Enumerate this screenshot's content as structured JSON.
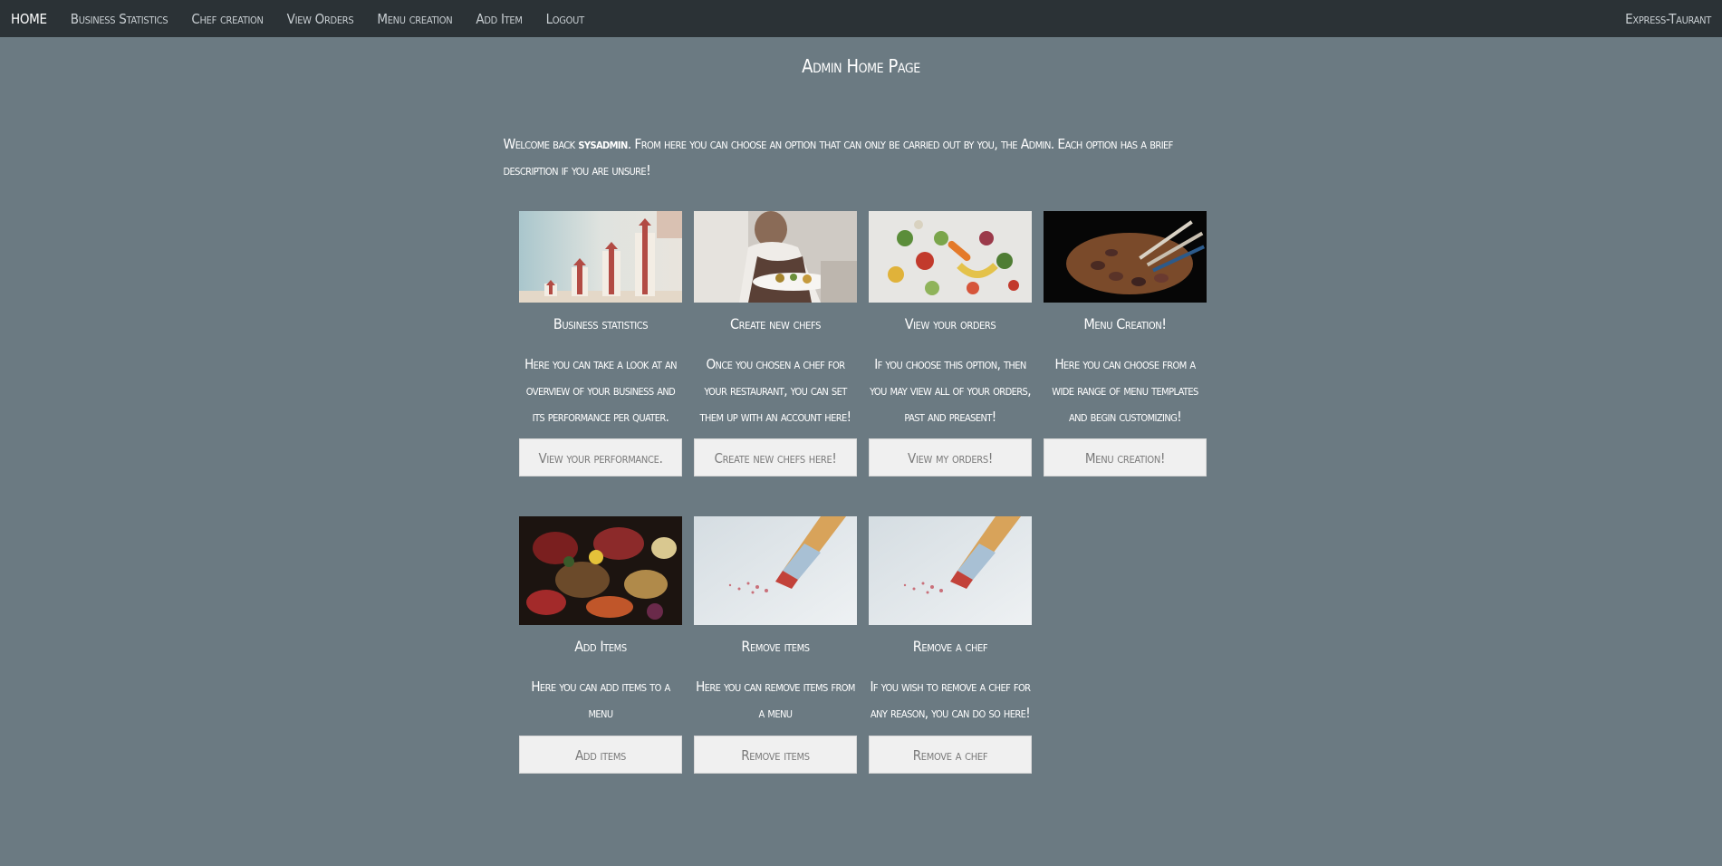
{
  "nav": {
    "items": [
      "HOME",
      "Business Statistics",
      "Chef creation",
      "View Orders",
      "Menu creation",
      "Add Item",
      "Logout"
    ],
    "brand": "Express-Taurant"
  },
  "page": {
    "title": "Admin Home Page",
    "welcome_prefix": "Welcome back ",
    "username": "sysadmin",
    "welcome_suffix": ". From here you can choose an option that can only be carried out by you, the Admin. Each option has a brief description if you are unsure!"
  },
  "cards": [
    {
      "title": "Business statistics",
      "desc": "Here you can take a look at an overview of your business and its performance per quater.",
      "button": "View your performance.",
      "image": "growth-chart-image"
    },
    {
      "title": "Create new chefs",
      "desc": "Once you chosen a chef for your restaurant, you can set them up with an account here!",
      "button": "Create new chefs here!",
      "image": "chef-cooking-image"
    },
    {
      "title": "View your orders",
      "desc": "If you choose this option, then you may view all of your orders, past and preasent!",
      "button": "View my orders!",
      "image": "vegetables-image"
    },
    {
      "title": "Menu Creation!",
      "desc": "Here you can choose from a wide range of menu templates and begin customizing!",
      "button": "Menu creation!",
      "image": "paint-palette-image"
    },
    {
      "title": "Add Items",
      "desc": "Here you can add items to a menu",
      "button": "Add items",
      "image": "food-spread-image"
    },
    {
      "title": "Remove items",
      "desc": "Here you can remove items from a menu",
      "button": "Remove items",
      "image": "pencil-eraser-image"
    },
    {
      "title": "Remove a chef",
      "desc": "If you wish to remove a chef for any reason, you can do so here!",
      "button": "Remove a chef",
      "image": "pencil-eraser-image"
    }
  ]
}
